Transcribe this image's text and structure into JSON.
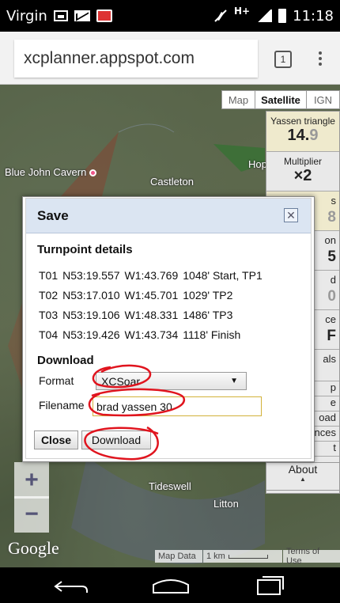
{
  "status_bar": {
    "carrier": "Virgin",
    "network": "H+",
    "time": "11:18",
    "icons": [
      "screenshot-icon",
      "mail-icon",
      "app-notification-icon",
      "mute-icon",
      "signal-icon",
      "battery-icon"
    ]
  },
  "browser": {
    "url": "xcplanner.appspot.com",
    "tab_count": "1"
  },
  "map": {
    "types": [
      "Map",
      "Satellite",
      "IGN"
    ],
    "active_type": "Satellite",
    "places": [
      "Blue John Cavern",
      "Castleton",
      "Hop",
      "Tideswell",
      "Litton"
    ],
    "attribution": {
      "map_data": "Map Data",
      "scale": "1 km",
      "terms": "Terms of Use"
    },
    "logo": "Google",
    "zoom_in": "+",
    "zoom_out": "−"
  },
  "side_panel": {
    "route_name": "Yassen triangle",
    "distance_int": "14.",
    "distance_dec": "9",
    "multiplier_label": "Multiplier",
    "multiplier_value": "×2",
    "partial_rows": [
      "s",
      "8",
      "on",
      "5",
      "d",
      "0",
      "ce",
      "F",
      "als",
      "p",
      "e",
      "oad",
      "nces",
      "t"
    ],
    "about": "About",
    "about_arrow": "▲"
  },
  "dialog": {
    "title": "Save",
    "close_symbol": "✕",
    "turnpoint_heading": "Turnpoint details",
    "turnpoints": [
      [
        "T01",
        "N53:19.557",
        "W1:43.769",
        "1048' Start, TP1"
      ],
      [
        "T02",
        "N53:17.010",
        "W1:45.701",
        "1029' TP2"
      ],
      [
        "T03",
        "N53:19.106",
        "W1:48.331",
        "1486' TP3"
      ],
      [
        "T04",
        "N53:19.426",
        "W1:43.734",
        "1118' Finish"
      ]
    ],
    "download_heading": "Download",
    "format_label": "Format",
    "format_value": "XCSoar",
    "filename_label": "Filename",
    "filename_value": "brad yassen 30",
    "close_button": "Close",
    "download_button": "Download"
  },
  "colors": {
    "dialog_header": "#dbe5f2",
    "annotation": "#e0141e",
    "filename_border": "#d2b23a"
  }
}
